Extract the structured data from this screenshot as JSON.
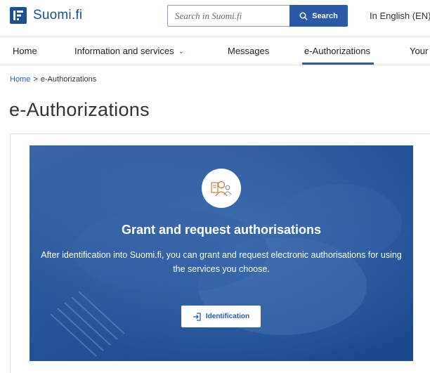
{
  "header": {
    "logo_text": "Suomi.fi",
    "search_placeholder": "Search in Suomi.fi",
    "search_button": "Search",
    "language": "In English (EN)"
  },
  "nav": {
    "items": [
      {
        "label": "Home"
      },
      {
        "label": "Information and services"
      },
      {
        "label": "Messages"
      },
      {
        "label": "e-Authorizations"
      },
      {
        "label": "Your"
      }
    ]
  },
  "breadcrumb": {
    "home": "Home",
    "separator": ">",
    "current": "e-Authorizations"
  },
  "page": {
    "title": "e-Authorizations"
  },
  "hero": {
    "title": "Grant and request authorisations",
    "description": "After identification into Suomi.fi, you can grant and request electronic authorisations for using the services you choose.",
    "button_label": "Identification",
    "icon": "person-documents-icon"
  },
  "colors": {
    "brand": "#1d4f91",
    "accent": "#2a5aa6",
    "hero_bg": "#1e4f97"
  }
}
